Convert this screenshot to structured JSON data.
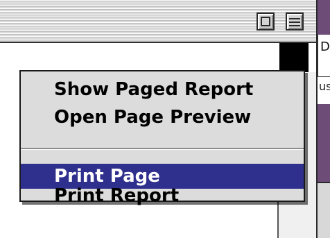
{
  "background_window": {
    "zoom_icon": "zoom-box-icon",
    "collapse_icon": "collapse-box-icon",
    "right_peek_letter": "D",
    "right_peek_text": "us"
  },
  "popup_menu": {
    "items": [
      {
        "label": "Show Paged Report",
        "selected": false
      },
      {
        "label": "Open Page Preview",
        "selected": false
      },
      {
        "label": "Print Page",
        "selected": true
      },
      {
        "label": "Print Report",
        "selected": false
      }
    ],
    "highlight_color": "#2f2f8e"
  }
}
